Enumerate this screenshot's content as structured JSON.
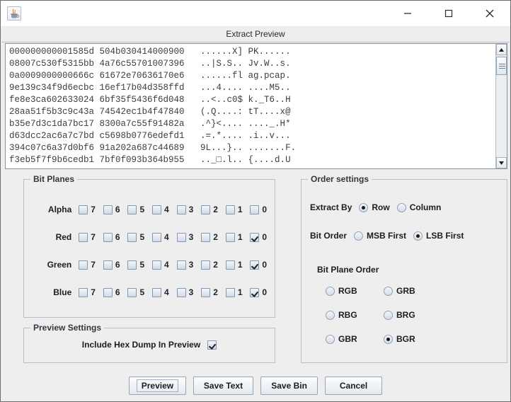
{
  "window": {
    "app_icon": "java-coffee-cup-icon",
    "minimize_label": "Minimize",
    "maximize_label": "Maximize",
    "close_label": "Close",
    "dialog_title": "Extract Preview"
  },
  "hex_dump": {
    "text": "000000000001585d 504b030414000900   ......X] PK......\n08007c530f5315bb 4a76c55701007396   ..|S.S.. Jv.W..s.\n0a0009000000666c 61672e70636170e6   ......fl ag.pcap.\n9e139c34f9d6ecbc 16ef17b04d358ffd   ...4.... ....M5..\nfe8e3ca602633024 6bf35f5436f6d048   ..<..c0$ k._T6..H\n28aa51f5b3c9c43a 74542ec1b4f47840   (.Q....: tT....x@\nb35e7d3c1da7bc17 8300a7c55f91482a   .^}<.... ...._.H*\nd63dcc2ac6a7c7bd c5698b0776edefd1   .=.*.... .i..v...\n394c07c6a37d0bf6 91a202a687c44689   9L...}.. .......F.\nf3eb5f7f9b6cedb1 7bf0f093b364b955   .._□.l.. {....d.U"
  },
  "bit_planes": {
    "group_label": "Bit Planes",
    "bit_numbers": [
      "7",
      "6",
      "5",
      "4",
      "3",
      "2",
      "1",
      "0"
    ],
    "rows": [
      {
        "label": "Alpha",
        "checked": [
          false,
          false,
          false,
          false,
          false,
          false,
          false,
          false
        ]
      },
      {
        "label": "Red",
        "checked": [
          false,
          false,
          false,
          false,
          false,
          false,
          false,
          true
        ]
      },
      {
        "label": "Green",
        "checked": [
          false,
          false,
          false,
          false,
          false,
          false,
          false,
          true
        ]
      },
      {
        "label": "Blue",
        "checked": [
          false,
          false,
          false,
          false,
          false,
          false,
          false,
          true
        ]
      }
    ]
  },
  "preview_settings": {
    "group_label": "Preview Settings",
    "include_hex_dump_label": "Include Hex Dump In Preview",
    "include_hex_dump_checked": true
  },
  "order_settings": {
    "group_label": "Order settings",
    "extract_by_label": "Extract By",
    "extract_by_options": [
      "Row",
      "Column"
    ],
    "extract_by_selected": "Row",
    "bit_order_label": "Bit Order",
    "bit_order_options": [
      "MSB First",
      "LSB First"
    ],
    "bit_order_selected": "LSB First",
    "bit_plane_order_label": "Bit Plane Order",
    "bit_plane_order_options": [
      "RGB",
      "GRB",
      "RBG",
      "BRG",
      "GBR",
      "BGR"
    ],
    "bit_plane_order_selected": "BGR"
  },
  "buttons": [
    {
      "label": "Preview",
      "focused": true
    },
    {
      "label": "Save Text",
      "focused": false
    },
    {
      "label": "Save Bin",
      "focused": false
    },
    {
      "label": "Cancel",
      "focused": false
    }
  ],
  "colors": {
    "window_bg": "#eeeeee",
    "titlebar_bg": "#ffffff",
    "panel_border": "#b6bfcb",
    "text": "#1c1c22",
    "hex_text": "#3c3c46"
  }
}
